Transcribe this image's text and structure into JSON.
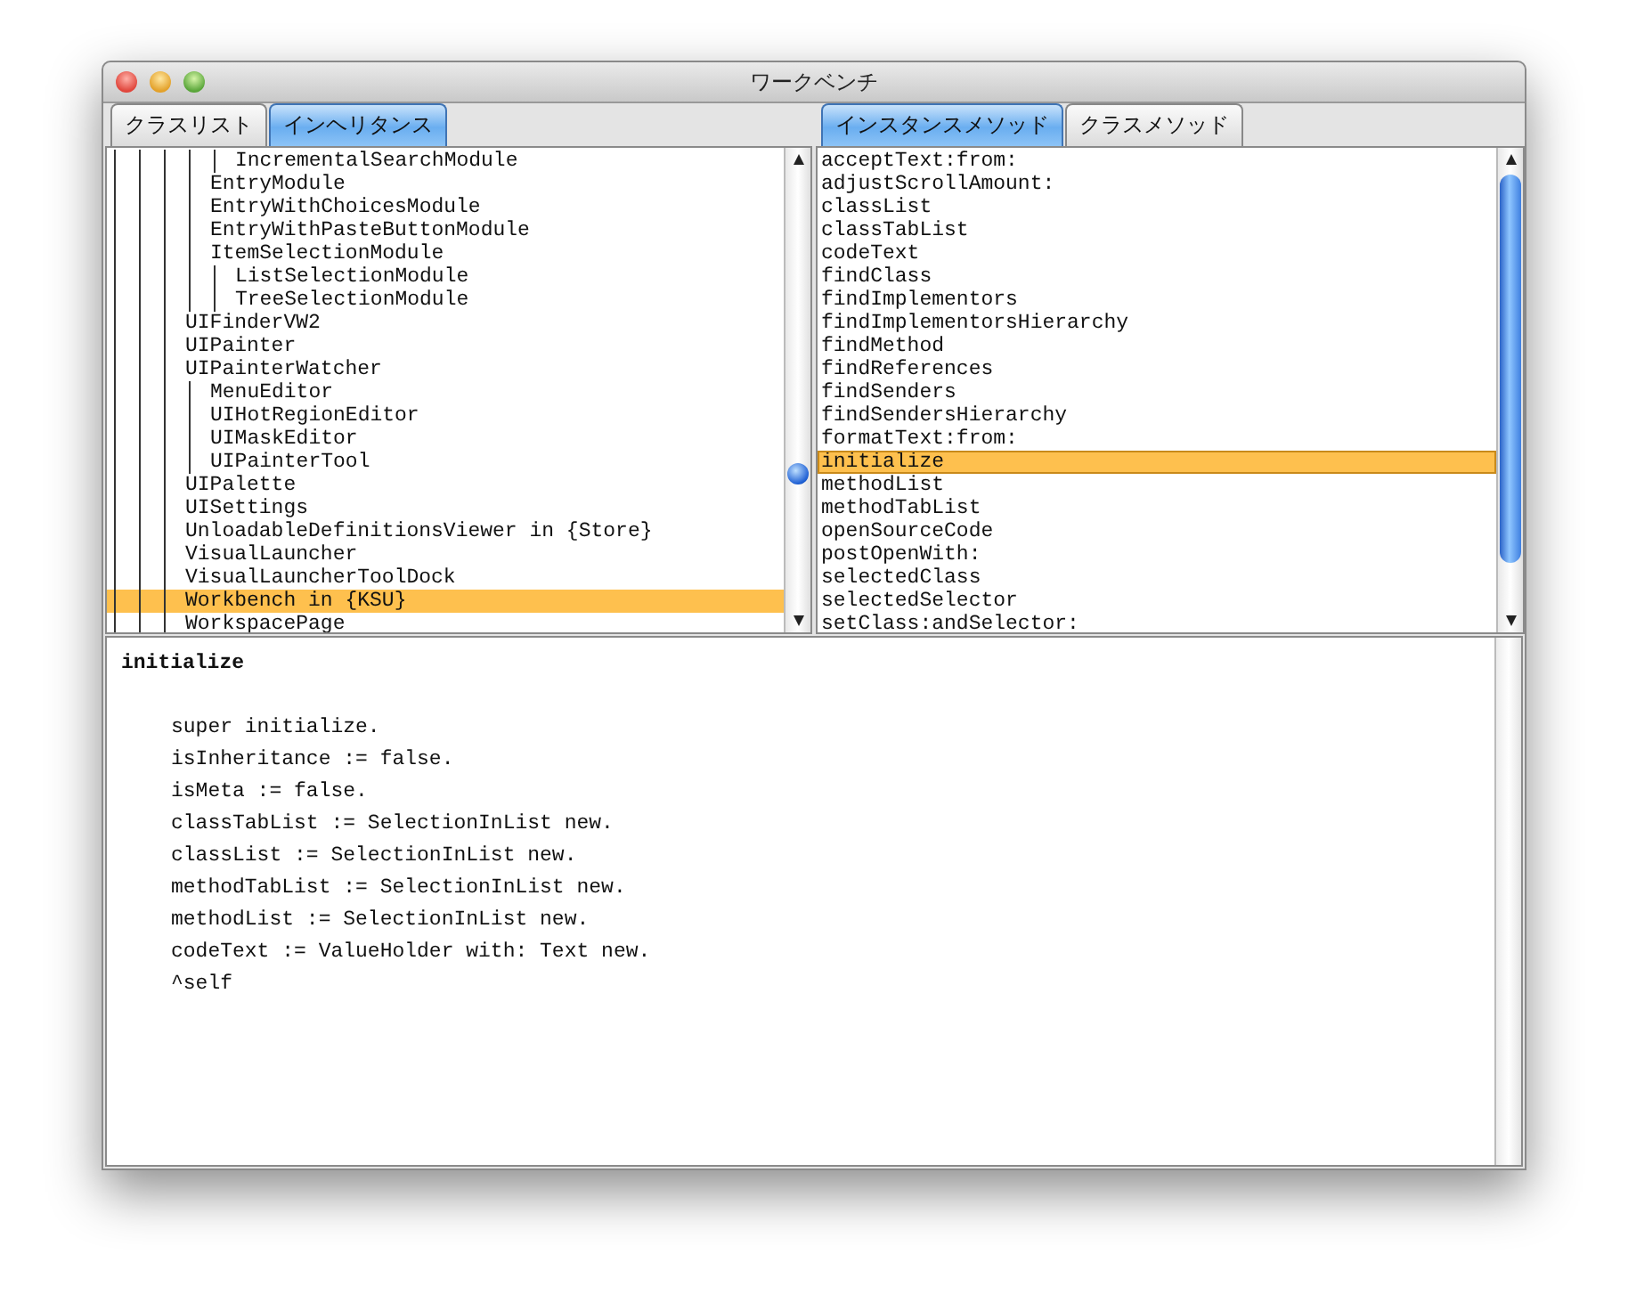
{
  "window": {
    "title": "ワークベンチ"
  },
  "class_tabs": [
    {
      "label": "クラスリスト",
      "selected": false
    },
    {
      "label": "インヘリタンス",
      "selected": true
    }
  ],
  "hierarchy": [
    {
      "children": [
        {
          "children": [
            {
              "label": "IncrementalSearchModule",
              "selected": false
            }
          ]
        },
        {
          "label": "EntryModule",
          "selected": false
        },
        {
          "label": "EntryWithChoicesModule",
          "selected": false
        },
        {
          "label": "EntryWithPasteButtonModule",
          "selected": false
        },
        {
          "label": "ItemSelectionModule",
          "selected": false,
          "children": [
            {
              "label": "ListSelectionModule",
              "selected": false
            },
            {
              "label": "TreeSelectionModule",
              "selected": false
            }
          ]
        }
      ]
    },
    {
      "label": "UIFinderVW2",
      "selected": false
    },
    {
      "label": "UIPainter",
      "selected": false
    },
    {
      "label": "UIPainterWatcher",
      "selected": false,
      "children": [
        {
          "label": "MenuEditor",
          "selected": false
        },
        {
          "label": "UIHotRegionEditor",
          "selected": false
        },
        {
          "label": "UIMaskEditor",
          "selected": false
        },
        {
          "label": "UIPainterTool",
          "selected": false
        }
      ]
    },
    {
      "label": "UIPalette",
      "selected": false
    },
    {
      "label": "UISettings",
      "selected": false
    },
    {
      "label": "UnloadableDefinitionsViewer in {Store}",
      "selected": false
    },
    {
      "label": "VisualLauncher",
      "selected": false
    },
    {
      "label": "VisualLauncherToolDock",
      "selected": false
    },
    {
      "label": "Workbench in {KSU}",
      "selected": true
    },
    {
      "label": "WorkspacePage",
      "selected": false
    }
  ],
  "method_tabs": [
    {
      "label": "インスタンスメソッド",
      "selected": true
    },
    {
      "label": "クラスメソッド",
      "selected": false
    }
  ],
  "methods": [
    {
      "label": "acceptText:from:",
      "selected": false
    },
    {
      "label": "adjustScrollAmount:",
      "selected": false
    },
    {
      "label": "classList",
      "selected": false
    },
    {
      "label": "classTabList",
      "selected": false
    },
    {
      "label": "codeText",
      "selected": false
    },
    {
      "label": "findClass",
      "selected": false
    },
    {
      "label": "findImplementors",
      "selected": false
    },
    {
      "label": "findImplementorsHierarchy",
      "selected": false
    },
    {
      "label": "findMethod",
      "selected": false
    },
    {
      "label": "findReferences",
      "selected": false
    },
    {
      "label": "findSenders",
      "selected": false
    },
    {
      "label": "findSendersHierarchy",
      "selected": false
    },
    {
      "label": "formatText:from:",
      "selected": false
    },
    {
      "label": "initialize",
      "selected": true
    },
    {
      "label": "methodList",
      "selected": false
    },
    {
      "label": "methodTabList",
      "selected": false
    },
    {
      "label": "openSourceCode",
      "selected": false
    },
    {
      "label": "postOpenWith:",
      "selected": false
    },
    {
      "label": "selectedClass",
      "selected": false
    },
    {
      "label": "selectedSelector",
      "selected": false
    },
    {
      "label": "setClass:andSelector:",
      "selected": false
    }
  ],
  "code": {
    "header": "initialize",
    "lines": [
      "super initialize.",
      "isInheritance := false.",
      "isMeta := false.",
      "classTabList := SelectionInList new.",
      "classList := SelectionInList new.",
      "methodTabList := SelectionInList new.",
      "methodList := SelectionInList new.",
      "codeText := ValueHolder with: Text new.",
      "^self"
    ]
  }
}
